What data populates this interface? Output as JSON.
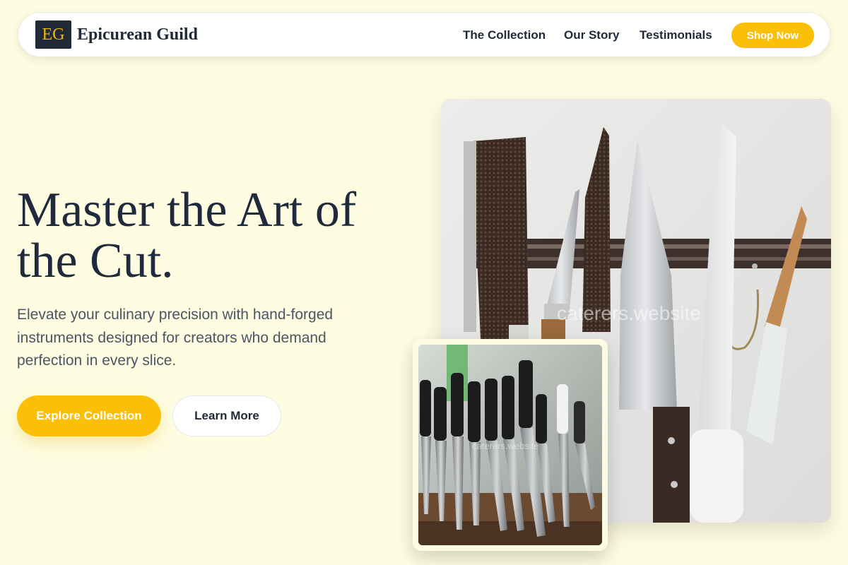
{
  "nav": {
    "logo_initials": "EG",
    "brand_name": "Epicurean Guild",
    "links": [
      "The Collection",
      "Our Story",
      "Testimonials"
    ],
    "cta_label": "Shop Now"
  },
  "hero": {
    "title": "Master the Art of the Cut.",
    "subtitle": "Elevate your culinary precision with hand-forged instruments designed for creators who demand perfection in every slice.",
    "primary_button": "Explore Collection",
    "secondary_button": "Learn More"
  },
  "images": {
    "main_watermark": "caterers.website",
    "inset_watermark": "caterers.website"
  },
  "colors": {
    "background": "#fefde2",
    "accent": "#fbbf07",
    "dark": "#1f2937"
  }
}
